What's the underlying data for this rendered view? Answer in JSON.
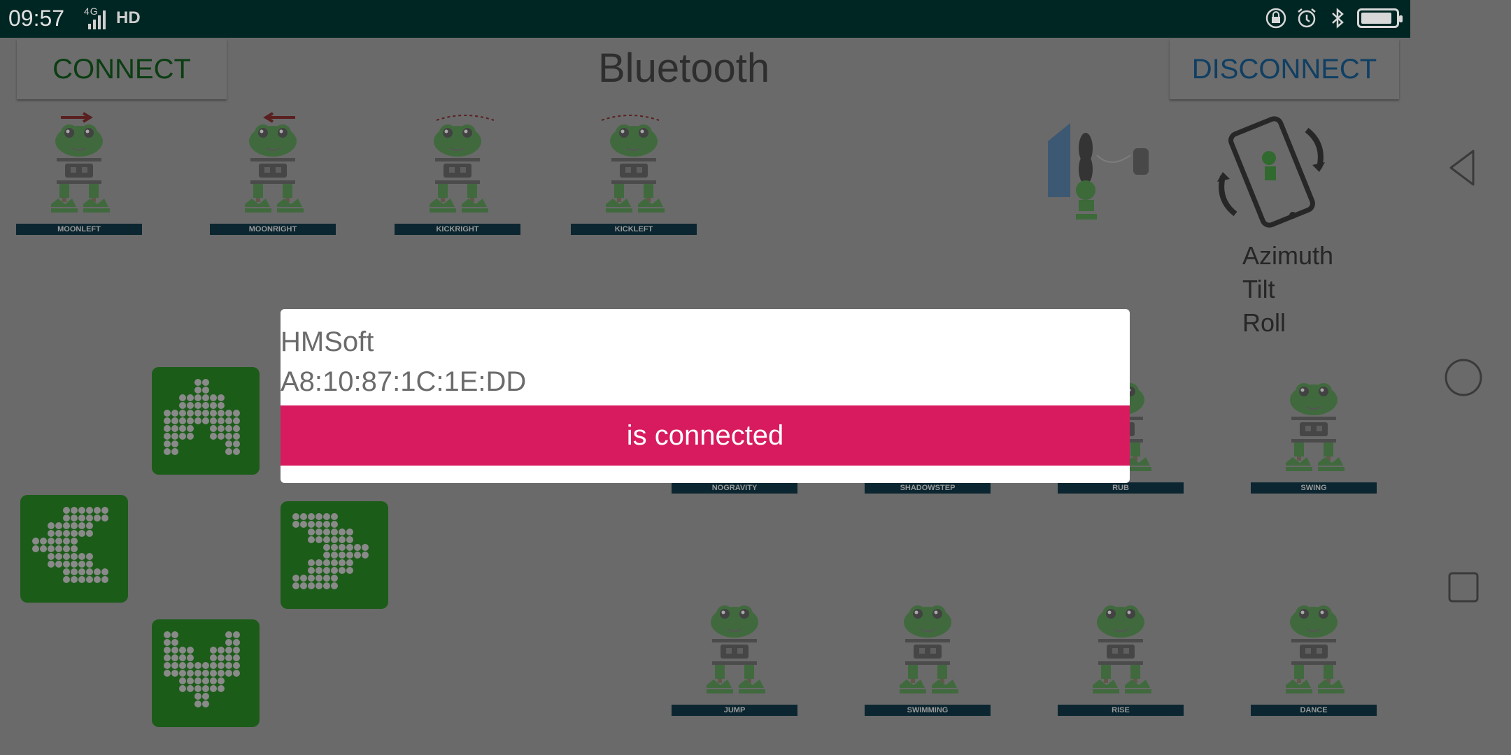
{
  "status_bar": {
    "time": "09:57",
    "network": "4G",
    "hd": "HD",
    "icons": [
      "lock-rotation-icon",
      "alarm-icon",
      "bluetooth-icon",
      "battery-icon"
    ],
    "battery_level": 0.9
  },
  "app_bar": {
    "connect_label": "CONNECT",
    "title": "Bluetooth",
    "disconnect_label": "DISCONNECT"
  },
  "moves_top": [
    {
      "label": "MOONLEFT"
    },
    {
      "label": "MOONRIGHT"
    },
    {
      "label": "KICKRIGHT"
    },
    {
      "label": "KICKLEFT"
    }
  ],
  "moves_mid": [
    {
      "label": "NOGRAVITY"
    },
    {
      "label": "SHADOWSTEP"
    },
    {
      "label": "RUB"
    },
    {
      "label": "SWING"
    }
  ],
  "moves_bottom": [
    {
      "label": "JUMP"
    },
    {
      "label": "SWIMMING"
    },
    {
      "label": "RISE"
    },
    {
      "label": "DANCE"
    }
  ],
  "orientation": {
    "azimuth": "Azimuth",
    "tilt": "Tilt",
    "roll": "Roll"
  },
  "dialog": {
    "device_name": "HMSoft",
    "device_address": "A8:10:87:1C:1E:DD",
    "status": "is connected"
  },
  "colors": {
    "status_bar": "#002623",
    "pad_green": "#1c5c19",
    "banner": "#d81b5e",
    "label_bar": "#0b2630"
  }
}
